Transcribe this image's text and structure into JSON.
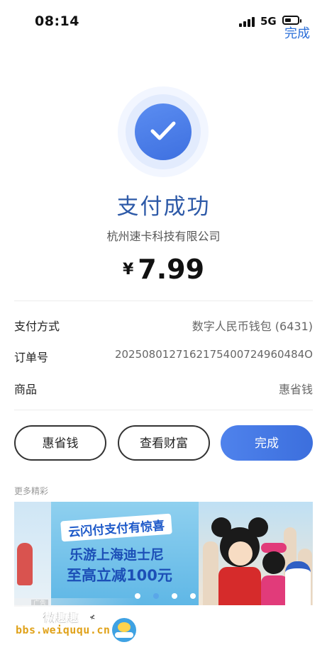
{
  "status_bar": {
    "time": "08:14",
    "network": "5G"
  },
  "header": {
    "done_label": "完成"
  },
  "result": {
    "title": "支付成功",
    "merchant": "杭州速卡科技有限公司",
    "currency_symbol": "¥",
    "amount": "7.99"
  },
  "details": [
    {
      "label": "支付方式",
      "value": "数字人民币钱包 (6431)"
    },
    {
      "label": "订单号",
      "value": "2025080127162175400724960484O"
    },
    {
      "label": "商品",
      "value": "惠省钱"
    }
  ],
  "actions": {
    "btn1": "惠省钱",
    "btn2": "查看财富",
    "btn3": "完成"
  },
  "more_section": {
    "label": "更多精彩"
  },
  "banner": {
    "line1": "云闪付支付有惊喜",
    "line2": "乐游上海迪士尼",
    "line3": "至高立减100元",
    "ad_tag": "广告"
  },
  "watermark": {
    "title": "微趣趣",
    "mark": "≮",
    "url": "bbs.weiququ.cn"
  },
  "colors": {
    "accent": "#3e70e0",
    "title": "#2e5aa8"
  }
}
